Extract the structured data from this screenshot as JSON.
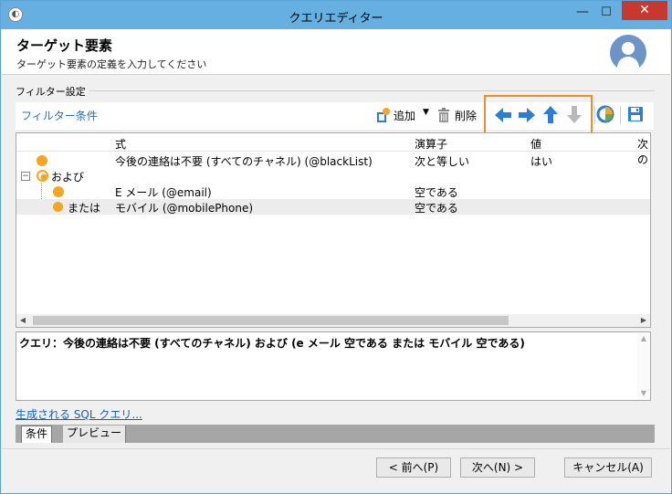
{
  "window": {
    "title": "クエリエディター",
    "min_glyph": "—",
    "max_glyph": "☐",
    "close_glyph": "✕"
  },
  "header": {
    "title": "ターゲット要素",
    "subtitle": "ターゲット要素の定義を入力してください"
  },
  "group": {
    "label": "フィルター設定"
  },
  "toolbar": {
    "filter_conditions": "フィルター条件",
    "add_label": "追加",
    "dropdown_caret": "▼",
    "delete_label": "削除"
  },
  "grid": {
    "columns": [
      "式",
      "演算子",
      "値",
      "次の"
    ],
    "rows": [
      {
        "prefix": "",
        "expression": "今後の連絡は不要 (すべてのチャネル) (@blackList)",
        "operator": "次と等しい",
        "value": "はい"
      },
      {
        "prefix": "および",
        "expression": "",
        "operator": "",
        "value": ""
      },
      {
        "prefix": "",
        "expression": "E メール (@email)",
        "operator": "空である",
        "value": ""
      },
      {
        "prefix": "または",
        "expression": "モバイル (@mobilePhone)",
        "operator": "空である",
        "value": ""
      }
    ],
    "toggle_glyph": "−"
  },
  "query_text": "クエリ：今後の連絡は不要 (すべてのチャネル) および (e メール 空である または モバイル 空である)",
  "sql_link": "生成される SQL クエリ...",
  "tabs": [
    "条件",
    "プレビュー"
  ],
  "buttons": {
    "prev": "< 前へ(P)",
    "next": "次へ(N) >",
    "cancel": "キャンセル(A)"
  },
  "colors": {
    "titlebar": "#65b0e1",
    "close": "#c7382e",
    "highlight": "#f28c28",
    "arrow_blue": "#2a7fd4",
    "arrow_disabled": "#b8b8b8",
    "dot": "#f5a623"
  }
}
